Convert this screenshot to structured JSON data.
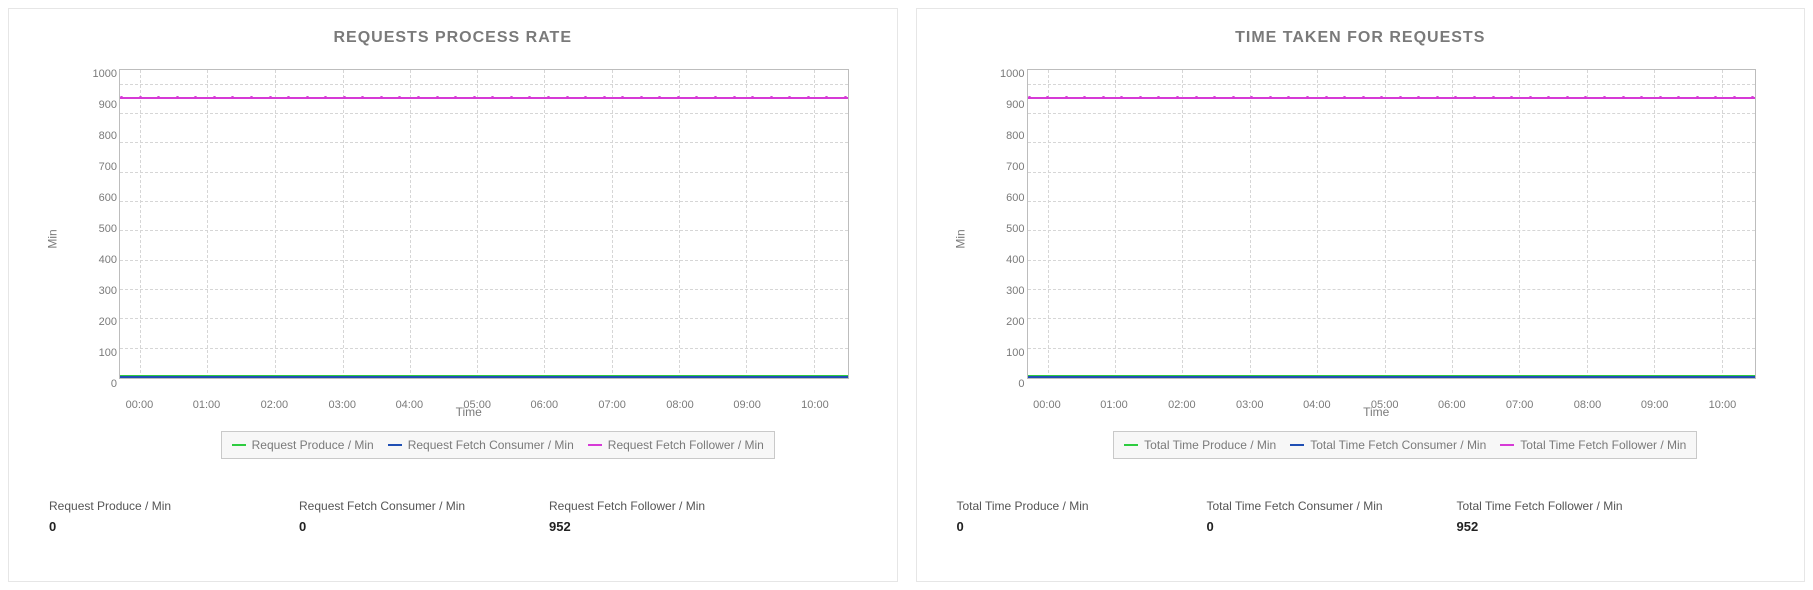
{
  "panels": [
    {
      "title": "REQUESTS PROCESS RATE",
      "ylabel": "Min",
      "xlabel": "Time",
      "legend": [
        {
          "label": "Request Produce / Min",
          "color": "#2ecc40"
        },
        {
          "label": "Request Fetch Consumer / Min",
          "color": "#1f4fb4"
        },
        {
          "label": "Request Fetch Follower / Min",
          "color": "#d63ad6"
        }
      ],
      "stats": [
        {
          "label": "Request Produce / Min",
          "value": "0"
        },
        {
          "label": "Request Fetch Consumer / Min",
          "value": "0"
        },
        {
          "label": "Request Fetch Follower / Min",
          "value": "952"
        }
      ]
    },
    {
      "title": "TIME TAKEN FOR REQUESTS",
      "ylabel": "Min",
      "xlabel": "Time",
      "legend": [
        {
          "label": "Total Time Produce / Min",
          "color": "#2ecc40"
        },
        {
          "label": "Total Time Fetch Consumer / Min",
          "color": "#1f4fb4"
        },
        {
          "label": "Total Time Fetch Follower / Min",
          "color": "#d63ad6"
        }
      ],
      "stats": [
        {
          "label": "Total Time Produce / Min",
          "value": "0"
        },
        {
          "label": "Total Time Fetch Consumer / Min",
          "value": "0"
        },
        {
          "label": "Total Time Fetch Follower / Min",
          "value": "952"
        }
      ]
    }
  ],
  "y_ticks": [
    "0",
    "100",
    "200",
    "300",
    "400",
    "500",
    "600",
    "700",
    "800",
    "900",
    "1000"
  ],
  "x_ticks": [
    "00:00",
    "01:00",
    "02:00",
    "03:00",
    "04:00",
    "05:00",
    "06:00",
    "07:00",
    "08:00",
    "09:00",
    "10:00"
  ],
  "chart_data": [
    {
      "type": "line",
      "title": "REQUESTS PROCESS RATE",
      "xlabel": "Time",
      "ylabel": "Min",
      "ylim": [
        0,
        1050
      ],
      "x": [
        "00:00",
        "01:00",
        "02:00",
        "03:00",
        "04:00",
        "05:00",
        "06:00",
        "07:00",
        "08:00",
        "09:00",
        "10:00"
      ],
      "series": [
        {
          "name": "Request Produce / Min",
          "color": "#2ecc40",
          "values": [
            0,
            0,
            0,
            0,
            0,
            0,
            0,
            0,
            0,
            0,
            0
          ]
        },
        {
          "name": "Request Fetch Consumer / Min",
          "color": "#1f4fb4",
          "values": [
            0,
            0,
            0,
            0,
            0,
            0,
            0,
            0,
            0,
            0,
            0
          ]
        },
        {
          "name": "Request Fetch Follower / Min",
          "color": "#d63ad6",
          "values": [
            952,
            952,
            952,
            952,
            958,
            952,
            952,
            952,
            952,
            956,
            952
          ]
        }
      ]
    },
    {
      "type": "line",
      "title": "TIME TAKEN FOR REQUESTS",
      "xlabel": "Time",
      "ylabel": "Min",
      "ylim": [
        0,
        1050
      ],
      "x": [
        "00:00",
        "01:00",
        "02:00",
        "03:00",
        "04:00",
        "05:00",
        "06:00",
        "07:00",
        "08:00",
        "09:00",
        "10:00"
      ],
      "series": [
        {
          "name": "Total Time Produce / Min",
          "color": "#2ecc40",
          "values": [
            0,
            0,
            0,
            0,
            0,
            0,
            0,
            0,
            0,
            0,
            0
          ]
        },
        {
          "name": "Total Time Fetch Consumer / Min",
          "color": "#1f4fb4",
          "values": [
            0,
            0,
            0,
            0,
            0,
            0,
            0,
            0,
            0,
            0,
            0
          ]
        },
        {
          "name": "Total Time Fetch Follower / Min",
          "color": "#d63ad6",
          "values": [
            952,
            952,
            952,
            952,
            958,
            952,
            952,
            952,
            952,
            956,
            952
          ]
        }
      ]
    }
  ]
}
